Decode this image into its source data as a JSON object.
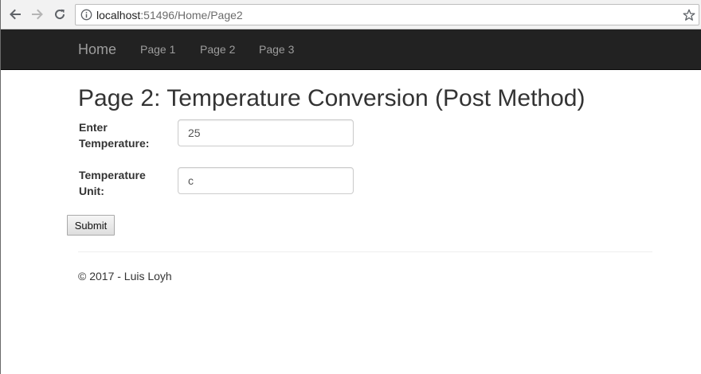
{
  "browser": {
    "url_host": "localhost",
    "url_path": ":51496/Home/Page2"
  },
  "navbar": {
    "brand": "Home",
    "links": [
      "Page 1",
      "Page 2",
      "Page 3"
    ]
  },
  "main": {
    "title": "Page 2: Temperature Conversion (Post Method)",
    "form": {
      "temperature_label_line1": "Enter",
      "temperature_label_line2": "Temperature:",
      "temperature_value": "25",
      "unit_label_line1": "Temperature",
      "unit_label_line2": "Unit:",
      "unit_value": "c",
      "submit_label": "Submit"
    }
  },
  "footer": {
    "text": "© 2017 - Luis Loyh"
  },
  "colors": {
    "navbar_bg": "#222222",
    "nav_link": "#9d9d9d",
    "text": "#333333"
  }
}
